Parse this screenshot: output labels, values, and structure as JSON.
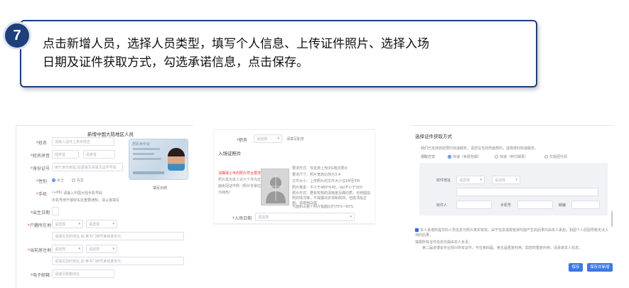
{
  "step": {
    "number": "7"
  },
  "instruction": {
    "line1": "点击新增人员，选择人员类型，填写个人信息、上传证件照片、选择入场",
    "line2": "日期及证件获取方式，勾选承诺信息，点击保存。"
  },
  "panel1": {
    "title": "新增中国大陆地区人员",
    "fields": [
      {
        "label": "姓名",
        "placeholder": "请输入证件上真实姓名"
      },
      {
        "label": "姓名拼音",
        "placeholder": "姓拼音",
        "placeholder2": "名拼音"
      },
      {
        "label": "身份证号",
        "placeholder": "用于身份核验,如需填写请填写证件号码"
      },
      {
        "label": "性别",
        "opt1": "女士",
        "opt2": "先生"
      },
      {
        "label": "手机",
        "prefix": "(+86)",
        "placeholder": "请输入中国大陆手机号码",
        "hint": "手机号用于接收实名重要通知，请认真填写"
      },
      {
        "label": "出生日期"
      },
      {
        "label": "户籍所在地",
        "placeholder": "请选择",
        "placeholder2": "请选择",
        "detail": "请填写您的地址,如:某市门牌号某栋某单元"
      },
      {
        "label": "当前居住地",
        "placeholder": "请选择",
        "placeholder2": "请选择",
        "detail": "请填写您的地址,如:某市门牌号某栋某单元"
      },
      {
        "label": "电子邮箱",
        "placeholder": "请填写邮箱地址"
      }
    ],
    "card_caption": "填写示例",
    "card_header": "居民身份证"
  },
  "panel2": {
    "field_label": "职务",
    "field_placeholder": "请选择",
    "field_placeholder2": "请填写职务",
    "section_title": "入场证照片",
    "warn": [
      "请确保上传的照片符合要求",
      "照片需为本人近六个月内正",
      "面免冠证件照（照片背景应",
      "为纯色）"
    ],
    "reqs": [
      "要求形式：仅支持上传JPG格式照片",
      "要求尺寸：照片宽高比例为3:4",
      "文件大小：上传照片的文件大小在1M至5M",
      "照片像素：不小于480*640，dpi不小于300",
      "照片形式：要有较规的清晰度及确切质，无修图拍照的情况等，不得露出衣领和佩饰，但底须拍正面，请使用白底",
      "与面积占整个照片幅面比约70%~80%"
    ],
    "date_label": "入场日期",
    "date_placeholder": "请选择"
  },
  "panel3": {
    "title": "选择证件获取方式",
    "desc": "我们已支持自助预约快递服务，请您在当前界面预约，选择便利快递服务。",
    "method_label": "领取方式",
    "methods": [
      "快递（免费包邮）",
      "快递（到付邮费）",
      "交易团代领"
    ],
    "addr_label": "收件地址",
    "addr_sel1": "请选择",
    "addr_sel2": "请选择",
    "person_label": "收件人",
    "phone_label": "手机号",
    "zip_label": "邮编",
    "note": [
      "本人承诺所提交的人员信息与照片真实有效。由于信息填报错误可能产生的后果均由本人承担，如因个人原因导致无法入场的后果，",
      "填报所有证件信息均需由本人负责，",
      "第二届进博会专业观众所有证件，可在第四届、第五届重复利用。如您的重复利用，请承诺本人信息。"
    ],
    "save_label": "保存",
    "save_new_label": "保存并新增"
  }
}
